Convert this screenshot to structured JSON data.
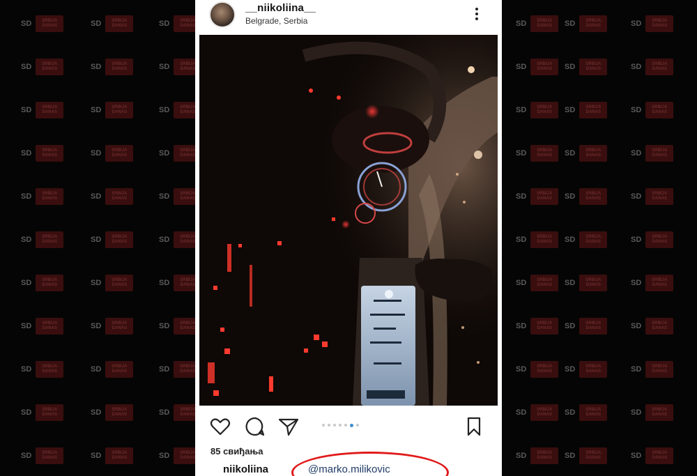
{
  "watermark": {
    "text": "SD",
    "badge_text": "SRBIJA DANAS"
  },
  "post": {
    "username": "__niikoliina__",
    "location": "Belgrade, Serbia",
    "photo_description_icon": "car-dashboard-photo",
    "carousel": {
      "count": 7,
      "active_index": 5
    },
    "likes": "85 свиђања",
    "caption_user": "niikoliina",
    "mention": "@marko.milikovic",
    "highlight_color": "#e11a1a"
  },
  "icons": {
    "heart": "heart-icon",
    "comment": "comment-icon",
    "share": "share-icon",
    "bookmark": "bookmark-icon",
    "more": "more-icon"
  }
}
